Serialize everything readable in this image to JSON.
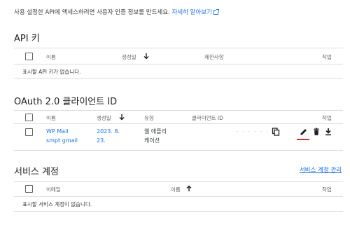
{
  "intro": {
    "text": "사용 설정한 API에 액세스하려면 사용자 인증 정보를 만드세요.",
    "link": "자세히 알아보기"
  },
  "api_keys": {
    "title": "API 키",
    "columns": {
      "name": "이름",
      "created": "생성일",
      "restrictions": "제한사항",
      "actions": "작업"
    },
    "empty": "표시할 API 키가 없습니다."
  },
  "oauth": {
    "title": "OAuth 2.0 클라이언트 ID",
    "columns": {
      "name": "이름",
      "created": "생성일",
      "type": "유형",
      "client_id": "클라이언트 ID",
      "actions": "작업"
    },
    "rows": [
      {
        "name_line1": "WP Mail",
        "name_line2": "smpt gmail",
        "created_line1": "2023. 8.",
        "created_line2": "23.",
        "type_line1": "웹 애플리",
        "type_line2": "케이션",
        "client_id": "· · · · · ·"
      }
    ]
  },
  "service_accounts": {
    "title": "서비스 계정",
    "manage_link": "서비스 계정 관리",
    "columns": {
      "email": "이메일",
      "name": "이름",
      "actions": "작업"
    },
    "empty": "표시할 서비스 계정이 없습니다."
  },
  "colors": {
    "link": "#1a73e8",
    "active_indicator": "#d93025",
    "divider": "#dadce0"
  }
}
